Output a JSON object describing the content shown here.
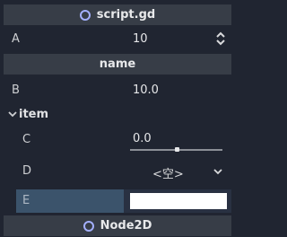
{
  "sections": {
    "script": {
      "title": "script.gd",
      "icon": "circle-outline-icon"
    },
    "name": {
      "title": "name"
    },
    "node2d": {
      "title": "Node2D",
      "icon": "circle-outline-icon"
    }
  },
  "properties": {
    "A": {
      "label": "A",
      "value": "10",
      "icon": "up-down-spinner-icon"
    },
    "B": {
      "label": "B",
      "value": "10.0"
    },
    "group": {
      "label": "item",
      "icon": "chevron-down-icon"
    },
    "C": {
      "label": "C",
      "value": "0.0",
      "slider_fraction": 0.5
    },
    "D": {
      "label": "D",
      "value": "<空>",
      "icon": "chevron-down-icon"
    },
    "E": {
      "label": "E",
      "color": "#ffffff"
    }
  },
  "colors": {
    "background": "#202531",
    "header": "#373d47",
    "accent_icon": "#a4b0ff",
    "highlight_row": "#3b536b"
  }
}
